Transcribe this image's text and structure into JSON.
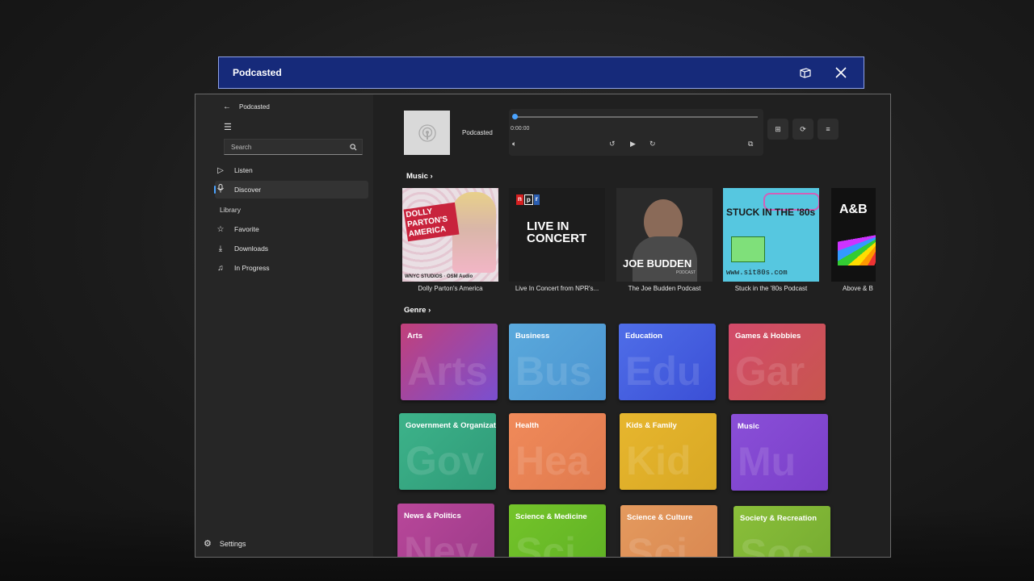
{
  "app": {
    "title": "Podcasted",
    "sidebar_title": "Podcasted"
  },
  "search": {
    "placeholder": "Search"
  },
  "nav": {
    "listen": "Listen",
    "discover": "Discover",
    "library_label": "Library",
    "favorite": "Favorite",
    "downloads": "Downloads",
    "in_progress": "In Progress",
    "settings": "Settings"
  },
  "player": {
    "title": "Podcasted",
    "time": "0:00:00",
    "progress": 0.0
  },
  "sections": {
    "music": "Music ›",
    "genre": "Genre ›"
  },
  "podcasts": [
    {
      "title": "Dolly Parton's America",
      "art_text": "DOLLY PARTON'S AMERICA",
      "credits": "WNYC STUDIOS · OSM Audio"
    },
    {
      "title": "Live In Concert from NPR's...",
      "logo": "npr",
      "art_text": "LIVE IN CONCERT"
    },
    {
      "title": "The Joe Budden Podcast",
      "art_text": "JOE BUDDEN",
      "sub": "PODCAST"
    },
    {
      "title": "Stuck in the '80s Podcast",
      "art_text": "STUCK IN THE '80s",
      "url": "www.sit80s.com"
    },
    {
      "title": "Above & B",
      "art_text": "A&B"
    }
  ],
  "genres": [
    {
      "label": "Arts",
      "wm": "Arts",
      "c1": "#c2407a",
      "c2": "#7a4fd0"
    },
    {
      "label": "Business",
      "wm": "Bus",
      "c1": "#5aa9dc",
      "c2": "#4b94d0"
    },
    {
      "label": "Education",
      "wm": "Edu",
      "c1": "#4f6ee8",
      "c2": "#3b4fd6"
    },
    {
      "label": "Games & Hobbies",
      "wm": "Gar",
      "c1": "#d24a6a",
      "c2": "#c8564e"
    },
    {
      "label": "Government & Organizations",
      "wm": "Gov",
      "c1": "#3db38a",
      "c2": "#2f9a78"
    },
    {
      "label": "Health",
      "wm": "Hea",
      "c1": "#f08a5a",
      "c2": "#e07a4e"
    },
    {
      "label": "Kids & Family",
      "wm": "Kid",
      "c1": "#e7b62e",
      "c2": "#d8a824"
    },
    {
      "label": "Music",
      "wm": "Mu",
      "c1": "#8a4fd8",
      "c2": "#7a3fc8"
    },
    {
      "label": "News & Politics",
      "wm": "Nev",
      "c1": "#b9479a",
      "c2": "#9a3a88"
    },
    {
      "label": "Science & Medicine",
      "wm": "Sci",
      "c1": "#74c42a",
      "c2": "#5eb024"
    },
    {
      "label": "Science & Culture",
      "wm": "Sci",
      "c1": "#e49a5e",
      "c2": "#d88650"
    },
    {
      "label": "Society & Recreation",
      "wm": "Soc",
      "c1": "#8abf3a",
      "c2": "#74aa30"
    }
  ],
  "icons": {
    "back": "back-arrow-icon",
    "menu": "hamburger-icon",
    "search": "search-icon",
    "listen": "play-outline-icon",
    "discover": "microphone-icon",
    "favorite": "star-icon",
    "downloads": "download-icon",
    "in_progress": "music-note-icon",
    "settings": "gear-icon"
  }
}
